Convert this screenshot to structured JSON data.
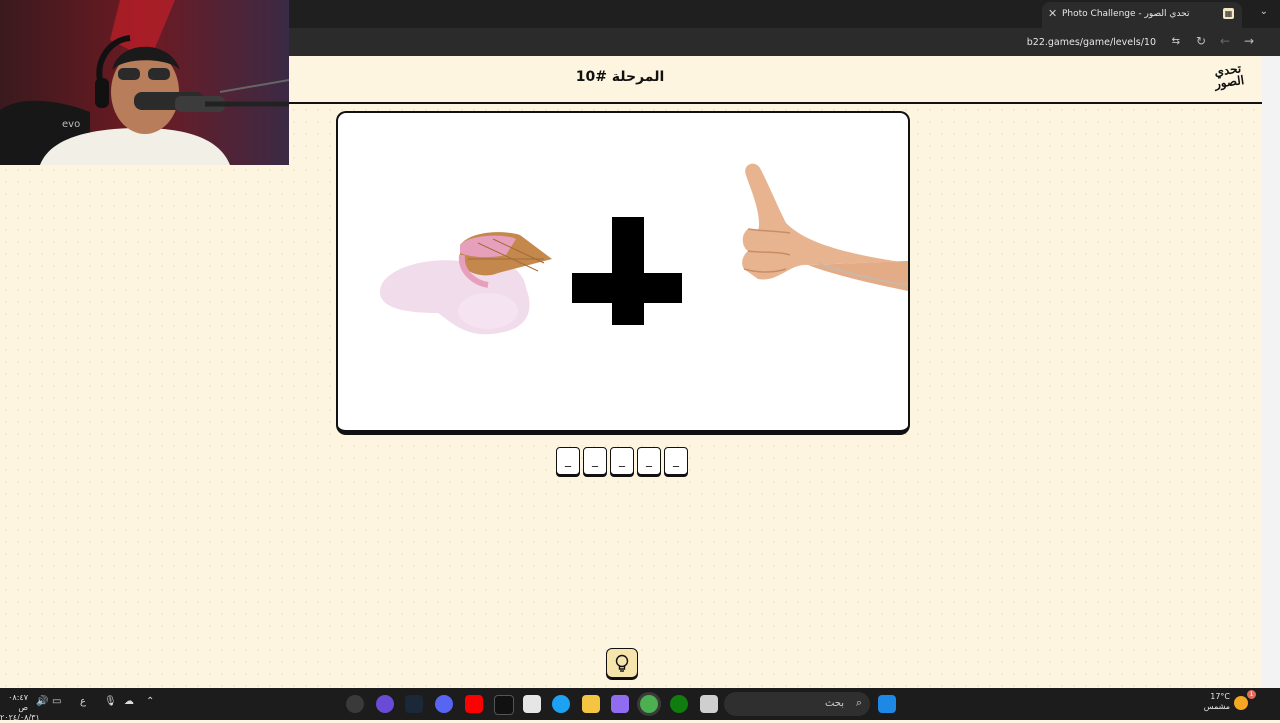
{
  "browser": {
    "tab_title": "Photo Challenge - تحدي الصور",
    "tab_close": "✕",
    "new_tab": "+",
    "tab_menu": "⌄",
    "url": "b22.games/game/levels/10"
  },
  "game": {
    "level_title": "المرحلة #10",
    "logo_line1": "تحدي",
    "logo_line2": "الصور",
    "answer_slots": [
      "_",
      "_",
      "_",
      "_",
      "_"
    ]
  },
  "taskbar": {
    "search_placeholder": "بحث",
    "weather_temp": "17°C",
    "weather_desc": "مشمس",
    "weather_badge": "1",
    "clock_time": "٠٨:٤٧ ص",
    "clock_date": "٢٠٢٤/٠٨/٣١",
    "lang": "ع"
  },
  "colors": {
    "page_bg": "#fdf5df",
    "hint_bg": "#f6e4ad",
    "accent_dark": "#111111"
  },
  "icons": [
    "tab-close-icon",
    "new-tab-icon",
    "refresh-icon",
    "back-icon",
    "forward-icon",
    "lightbulb-icon",
    "search-icon",
    "windows-start-icon"
  ]
}
